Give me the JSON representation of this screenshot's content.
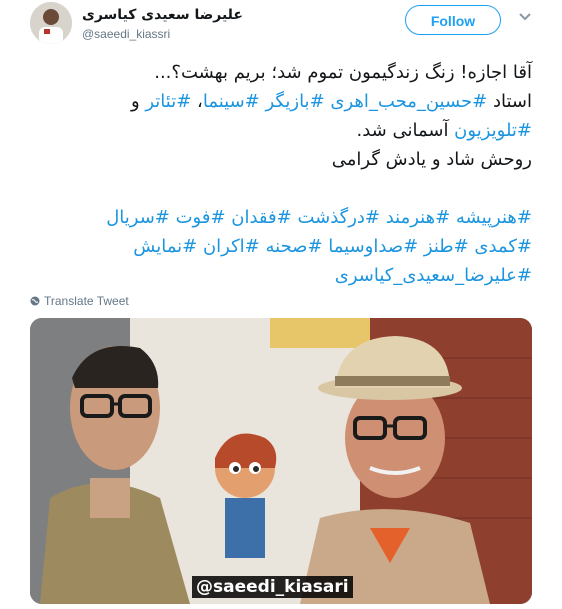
{
  "header": {
    "display_name": "علیرضا سعیدی کیاسری",
    "handle": "@saeedi_kiassri",
    "follow_label": "Follow"
  },
  "tweet": {
    "line1": "آقا اجازه! زنگ زندگیمون تموم شد؛ بریم بهشت؟...",
    "line2_prefix": "استاد ",
    "line2_tag1": "#حسین_محب_اهری",
    "line2_sep1": " ",
    "line2_tag2": "#بازیگر",
    "line2_sep2": " ",
    "line2_tag3": "#سینما",
    "line2_sep3": "، ",
    "line2_tag4": "#تئاتر",
    "line2_suffix": " و",
    "line3_tag": "#تلویزیون",
    "line3_suffix": " آسمانی شد.",
    "line4": "روحش شاد و یادش گرامی",
    "tags_line1": "#هنرپیشه #هنرمند #درگذشت #فقدان #فوت #سریال",
    "tags_line2": "#کمدی #طنز #صداوسیما #صحنه #اکران #نمایش",
    "tags_line3": "#علیرضا_سعیدی_کیاسری"
  },
  "translate_label": "Translate Tweet",
  "photo": {
    "watermark": "@saeedi_kiasari"
  },
  "colors": {
    "link": "#1b95e0",
    "follow": "#1da1f2",
    "muted": "#657786"
  },
  "icons": {
    "menu": "chevron-down-icon",
    "translate": "globe-icon"
  }
}
